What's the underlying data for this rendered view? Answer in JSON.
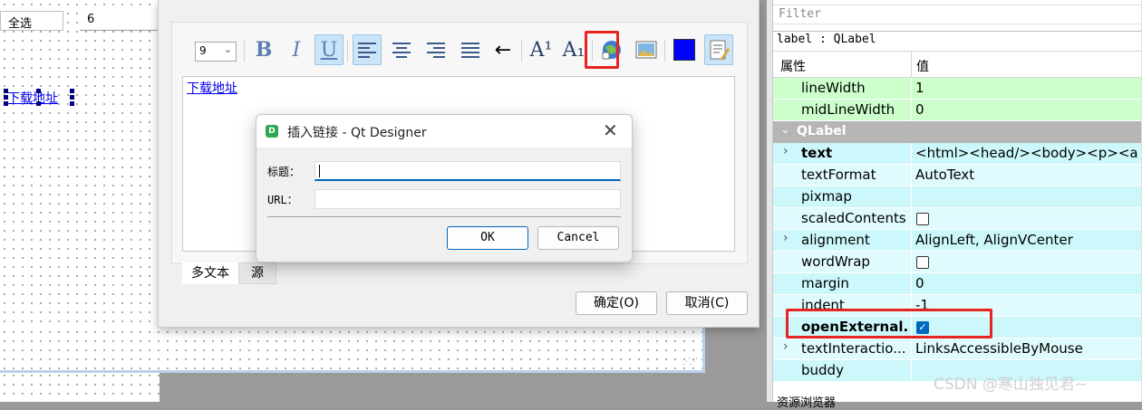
{
  "canvas": {
    "select_all_label": "全选",
    "spin_value": "6",
    "link_label": "下载地址"
  },
  "rich_dialog": {
    "font_size": "9",
    "toolbar": [
      {
        "name": "bold-icon",
        "glyph": "B"
      },
      {
        "name": "italic-icon",
        "glyph": "I"
      },
      {
        "name": "underline-icon",
        "glyph": "U"
      },
      {
        "name": "align-left-icon",
        "glyph": "≡"
      },
      {
        "name": "align-center-icon",
        "glyph": "≡"
      },
      {
        "name": "align-right-icon",
        "glyph": "≡"
      },
      {
        "name": "justify-icon",
        "glyph": "≡"
      },
      {
        "name": "text-direction-icon",
        "glyph": "←"
      },
      {
        "name": "superscript-icon",
        "glyph": "A¹"
      },
      {
        "name": "subscript-icon",
        "glyph": "A₁"
      },
      {
        "name": "insert-link-icon",
        "glyph": ""
      },
      {
        "name": "insert-image-icon",
        "glyph": ""
      },
      {
        "name": "text-color-icon",
        "glyph": ""
      },
      {
        "name": "simplify-rich-text-icon",
        "glyph": ""
      }
    ],
    "editor_link": "下载地址",
    "tab_rich": "多文本",
    "tab_source": "源",
    "ok_label": "确定(O)",
    "cancel_label": "取消(C)"
  },
  "link_dialog": {
    "title": "插入链接 - Qt Designer",
    "app_icon_letter": "D",
    "title_label": "标题：",
    "url_label": "URL：",
    "title_value": "",
    "url_value": "",
    "ok_label": "OK",
    "cancel_label": "Cancel"
  },
  "property_editor": {
    "filter_placeholder": "Filter",
    "object_label": "label : QLabel",
    "col_property": "属性",
    "col_value": "值",
    "rows_before_group": [
      {
        "name": "lineWidth",
        "value": "1"
      },
      {
        "name": "midLineWidth",
        "value": "0"
      }
    ],
    "group": "QLabel",
    "rows": [
      {
        "name": "text",
        "value": "<html><head/><body><p><a hre",
        "expand": true,
        "bold": true
      },
      {
        "name": "textFormat",
        "value": "AutoText"
      },
      {
        "name": "pixmap",
        "value": ""
      },
      {
        "name": "scaledContents",
        "value": "",
        "checkbox": true,
        "checked": false
      },
      {
        "name": "alignment",
        "value": "AlignLeft, AlignVCenter",
        "expand": true
      },
      {
        "name": "wordWrap",
        "value": "",
        "checkbox": true,
        "checked": false
      },
      {
        "name": "margin",
        "value": "0"
      },
      {
        "name": "indent",
        "value": "-1"
      },
      {
        "name": "openExternal...",
        "value": "",
        "checkbox": true,
        "checked": true,
        "bold": true
      },
      {
        "name": "textInteractio...",
        "value": "LinksAccessibleByMouse",
        "expand": true
      },
      {
        "name": "buddy",
        "value": ""
      }
    ],
    "bottom_label": "资源浏览器"
  },
  "watermark": "CSDN @寒山独见君~",
  "colors": {
    "row_green": "#ccffcc",
    "row_cyan": "#e0fbfd",
    "row_cyan_alt": "#ccf7fb",
    "highlight_red": "#e8241f",
    "accent_blue": "#0067c0"
  }
}
